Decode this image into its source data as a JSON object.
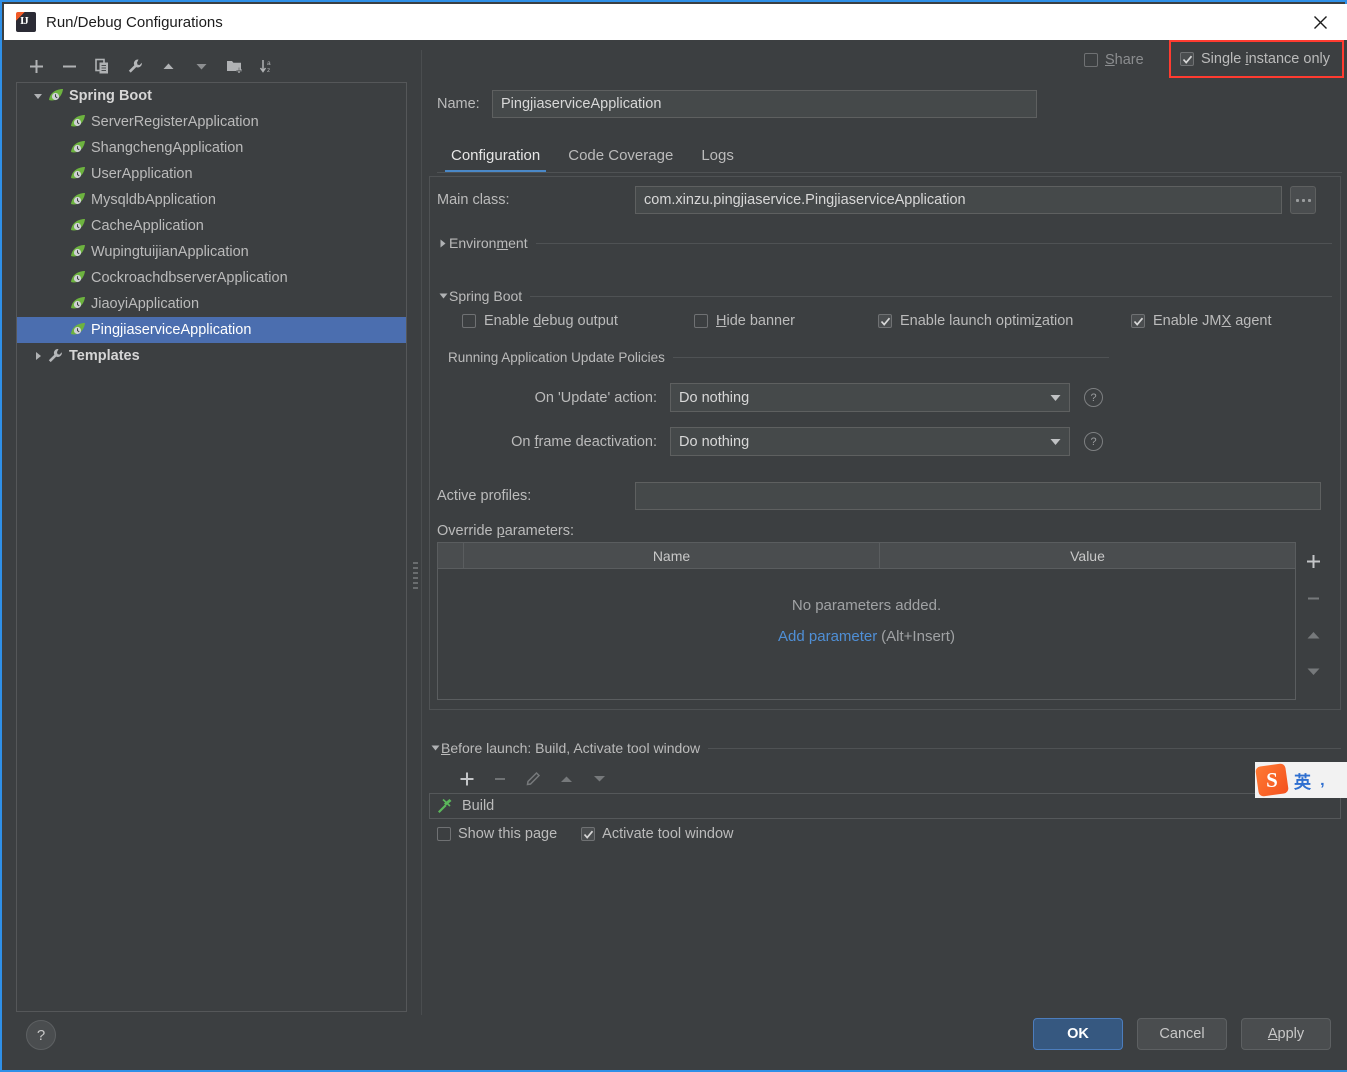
{
  "window": {
    "title": "Run/Debug Configurations",
    "close_icon": "close-icon"
  },
  "sidebar": {
    "toolbar": [
      {
        "name": "add",
        "icon": "plus-icon"
      },
      {
        "name": "remove",
        "icon": "minus-icon"
      },
      {
        "name": "copy",
        "icon": "copy-icon"
      },
      {
        "name": "edit-templates",
        "icon": "wrench-icon"
      },
      {
        "name": "move-up",
        "icon": "arrow-up-icon"
      },
      {
        "name": "move-down",
        "icon": "arrow-down-icon"
      },
      {
        "name": "new-folder",
        "icon": "folder-add-icon"
      },
      {
        "name": "sort-alphabetically",
        "icon": "sort-az-icon"
      }
    ],
    "tree": [
      {
        "label": "Spring Boot",
        "type": "group",
        "expanded": true,
        "icon": "spring-boot-icon",
        "selected": false
      },
      {
        "label": "ServerRegisterApplication",
        "type": "item",
        "icon": "spring-boot-icon",
        "selected": false
      },
      {
        "label": "ShangchengApplication",
        "type": "item",
        "icon": "spring-boot-icon",
        "selected": false
      },
      {
        "label": "UserApplication",
        "type": "item",
        "icon": "spring-boot-icon",
        "selected": false
      },
      {
        "label": "MysqldbApplication",
        "type": "item",
        "icon": "spring-boot-icon",
        "selected": false
      },
      {
        "label": "CacheApplication",
        "type": "item",
        "icon": "spring-boot-icon",
        "selected": false
      },
      {
        "label": "WupingtuijianApplication",
        "type": "item",
        "icon": "spring-boot-icon",
        "selected": false
      },
      {
        "label": "CockroachdbserverApplication",
        "type": "item",
        "icon": "spring-boot-icon",
        "selected": false
      },
      {
        "label": "JiaoyiApplication",
        "type": "item",
        "icon": "spring-boot-icon",
        "selected": false
      },
      {
        "label": "PingjiaserviceApplication",
        "type": "item",
        "icon": "spring-boot-icon",
        "selected": true
      },
      {
        "label": "Templates",
        "type": "group",
        "expanded": false,
        "icon": "wrench-icon",
        "selected": false
      }
    ]
  },
  "header": {
    "name_label": "Name:",
    "name_value": "PingjiaserviceApplication",
    "share_label": "Share",
    "share_checked": false,
    "single_instance_label": "Single instance only",
    "single_instance_checked": true,
    "highlight_color": "#ff3b30"
  },
  "tabs": [
    {
      "label": "Configuration",
      "active": true
    },
    {
      "label": "Code Coverage",
      "active": false
    },
    {
      "label": "Logs",
      "active": false
    }
  ],
  "configuration": {
    "main_class_label": "Main class:",
    "main_class_value": "com.xinzu.pingjiaservice.PingjiaserviceApplication",
    "browse_button": "...",
    "environment_section": "Environment",
    "spring_boot_section": "Spring Boot",
    "checkboxes": [
      {
        "label": "Enable debug output",
        "checked": false,
        "mnemonic": "d"
      },
      {
        "label": "Hide banner",
        "checked": false,
        "mnemonic": "H"
      },
      {
        "label": "Enable launch optimization",
        "checked": true,
        "mnemonic": "z"
      },
      {
        "label": "Enable JMX agent",
        "checked": true,
        "mnemonic": "X"
      }
    ],
    "policies_title": "Running Application Update Policies",
    "update_action_label": "On 'Update' action:",
    "update_action_value": "Do nothing",
    "frame_deactivation_label": "On frame deactivation:",
    "frame_deactivation_value": "Do nothing",
    "active_profiles_label": "Active profiles:",
    "active_profiles_value": "",
    "override_params_label": "Override parameters:",
    "table": {
      "columns": [
        "",
        "Name",
        "Value"
      ],
      "rows": [],
      "empty_message": "No parameters added.",
      "add_link": "Add parameter",
      "add_hint": "(Alt+Insert)"
    },
    "table_buttons": [
      {
        "name": "add-parameter",
        "icon": "plus-icon",
        "enabled": true
      },
      {
        "name": "remove-parameter",
        "icon": "minus-icon",
        "enabled": false
      },
      {
        "name": "move-parameter-up",
        "icon": "arrow-up-icon",
        "enabled": false
      },
      {
        "name": "move-parameter-down",
        "icon": "arrow-down-icon",
        "enabled": false
      }
    ]
  },
  "before_launch": {
    "section_title": "Before launch: Build, Activate tool window",
    "toolbar": [
      {
        "name": "add-task",
        "icon": "plus-icon",
        "enabled": true
      },
      {
        "name": "remove-task",
        "icon": "minus-icon",
        "enabled": false
      },
      {
        "name": "edit-task",
        "icon": "pencil-icon",
        "enabled": false
      },
      {
        "name": "move-task-up",
        "icon": "arrow-up-icon",
        "enabled": false
      },
      {
        "name": "move-task-down",
        "icon": "arrow-down-icon",
        "enabled": false
      }
    ],
    "tasks": [
      {
        "label": "Build",
        "icon": "build-hammer-icon"
      }
    ],
    "show_page_label": "Show this page",
    "show_page_checked": false,
    "activate_tool_window_label": "Activate tool window",
    "activate_tool_window_checked": true
  },
  "ime_widget": {
    "logo": "S",
    "mode": "英",
    "punct_icon": "comma-icon"
  },
  "footer": {
    "help_label": "?",
    "ok_label": "OK",
    "cancel_label": "Cancel",
    "apply_label": "Apply"
  }
}
